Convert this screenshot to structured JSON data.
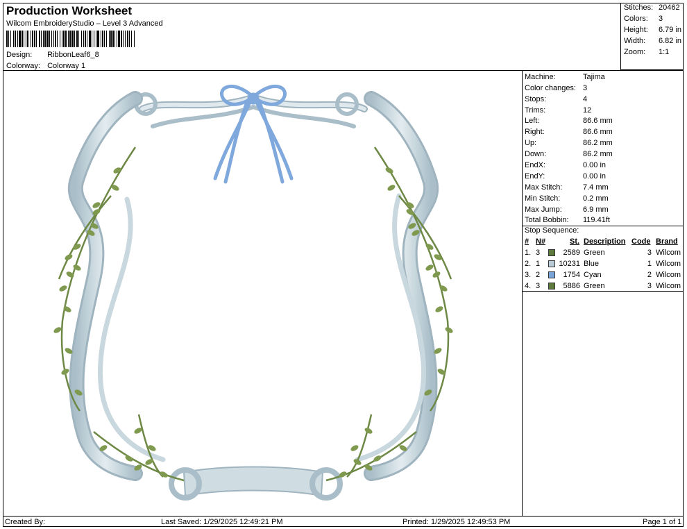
{
  "header": {
    "title": "Production Worksheet",
    "subtitle": "Wilcom EmbroideryStudio – Level 3 Advanced",
    "design_label": "Design:",
    "design_value": "RibbonLeaf6_8",
    "colorway_label": "Colorway:",
    "colorway_value": "Colorway 1"
  },
  "top_stats": {
    "stitches_label": "Stitches:",
    "stitches_value": "20462",
    "colors_label": "Colors:",
    "colors_value": "3",
    "height_label": "Height:",
    "height_value": "6.79 in",
    "width_label": "Width:",
    "width_value": "6.82 in",
    "zoom_label": "Zoom:",
    "zoom_value": "1:1"
  },
  "machine_info": [
    {
      "label": "Machine:",
      "value": "Tajima"
    },
    {
      "label": "Color changes:",
      "value": "3"
    },
    {
      "label": "Stops:",
      "value": "4"
    },
    {
      "label": "Trims:",
      "value": "12"
    },
    {
      "label": "Left:",
      "value": "86.6 mm"
    },
    {
      "label": "Right:",
      "value": "86.6 mm"
    },
    {
      "label": "Up:",
      "value": "86.2 mm"
    },
    {
      "label": "Down:",
      "value": "86.2 mm"
    },
    {
      "label": "EndX:",
      "value": "0.00 in"
    },
    {
      "label": "EndY:",
      "value": "0.00 in"
    },
    {
      "label": "Max Stitch:",
      "value": "7.4 mm"
    },
    {
      "label": "Min Stitch:",
      "value": "0.2 mm"
    },
    {
      "label": "Max Jump:",
      "value": "6.9 mm"
    },
    {
      "label": "Total Bobbin:",
      "value": "119.41ft"
    }
  ],
  "stop_sequence": {
    "title": "Stop Sequence:",
    "headers": {
      "num": "#",
      "needle": "N#",
      "st": "St.",
      "description": "Description",
      "code": "Code",
      "brand": "Brand"
    },
    "rows": [
      {
        "idx": "1.",
        "needle": "3",
        "color": "#5f7a3d",
        "st": "2589",
        "description": "Green",
        "code": "3",
        "brand": "Wilcom"
      },
      {
        "idx": "2.",
        "needle": "1",
        "color": "#b9cbd6",
        "st": "10231",
        "description": "Blue",
        "code": "1",
        "brand": "Wilcom"
      },
      {
        "idx": "3.",
        "needle": "2",
        "color": "#7aa3d9",
        "st": "1754",
        "description": "Cyan",
        "code": "2",
        "brand": "Wilcom"
      },
      {
        "idx": "4.",
        "needle": "3",
        "color": "#5f7a3d",
        "st": "5886",
        "description": "Green",
        "code": "3",
        "brand": "Wilcom"
      }
    ]
  },
  "footer": {
    "created_by": "Created By:",
    "last_saved": "Last Saved: 1/29/2025 12:49:21 PM",
    "printed": "Printed: 1/29/2025 12:49:53 PM",
    "page": "Page 1 of 1"
  },
  "colors": {
    "ribbon": "#c7d6de",
    "ribbon_shadow": "#9fb4bf",
    "leaf": "#7f9a4f",
    "stem": "#6e8845",
    "bow": "#7fa8dc"
  }
}
